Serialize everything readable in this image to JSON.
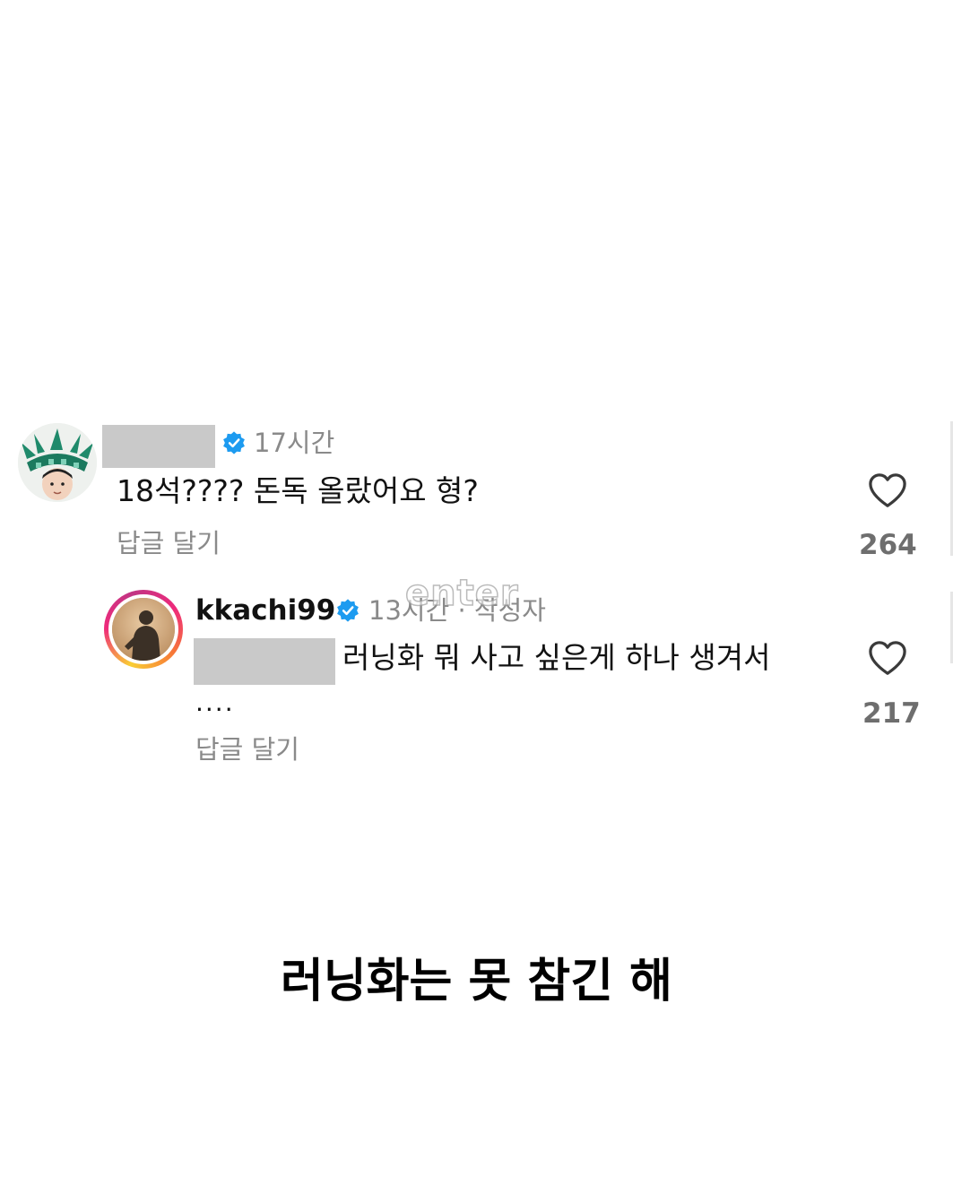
{
  "comment": {
    "time": "17시간",
    "text": "18석???? 돈독 올랐어요 형?",
    "reply_label": "답글 달기",
    "likes": "264"
  },
  "reply": {
    "username": "kkachi99",
    "meta": "13시간 · 작성자",
    "text": "러닝화 뭐 사고 싶은게 하나 생겨서",
    "text_cont": "....",
    "reply_label": "답글 달기",
    "likes": "217"
  },
  "watermark": "enter",
  "caption": "러닝화는 못 참긴 해",
  "colors": {
    "verified": "#1d9bf0",
    "secondary_text": "#8a8a8a",
    "redaction": "#c9c9c9",
    "story_ring_start": "#f9ce34",
    "story_ring_end": "#c13584"
  },
  "icons": {
    "verified": "verified-badge-icon",
    "like": "heart-outline-icon"
  }
}
